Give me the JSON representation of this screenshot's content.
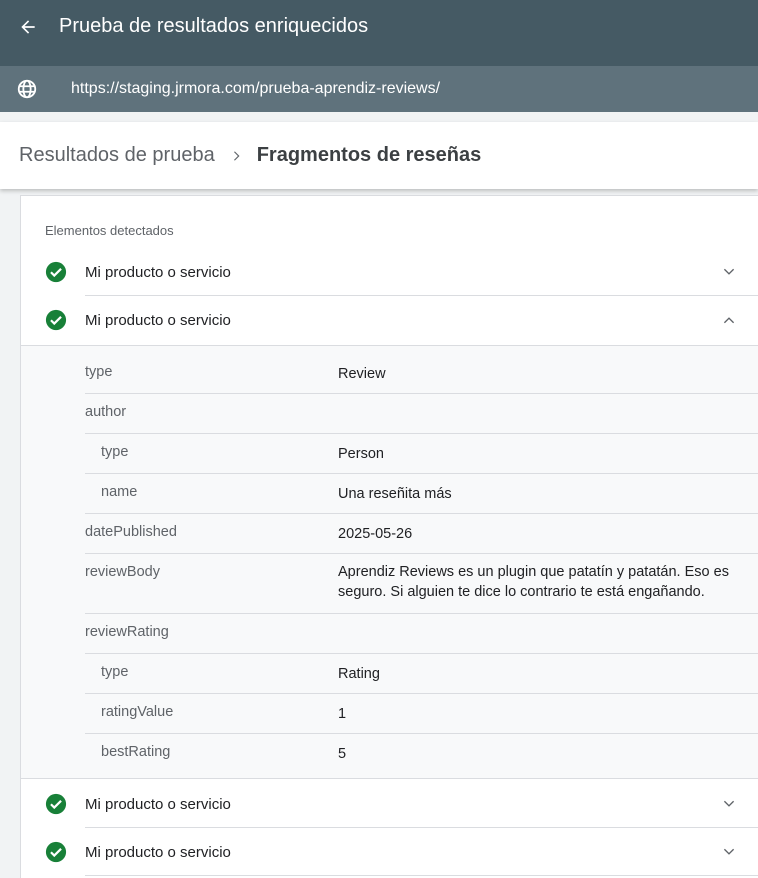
{
  "appbar": {
    "title": "Prueba de resultados enriquecidos",
    "back_icon": "arrow-back-icon"
  },
  "urlbar": {
    "url": "https://staging.jrmora.com/prueba-aprendiz-reviews/",
    "icon": "globe-icon"
  },
  "breadcrumb": {
    "parent": "Resultados de prueba",
    "current": "Fragmentos de reseñas",
    "separator_icon": "chevron-right-icon"
  },
  "detected": {
    "section_label": "Elementos detectados",
    "items": [
      {
        "label": "Mi producto o servicio",
        "expanded": false
      },
      {
        "label": "Mi producto o servicio",
        "expanded": true
      },
      {
        "label": "Mi producto o servicio",
        "expanded": false
      },
      {
        "label": "Mi producto o servicio",
        "expanded": false
      }
    ]
  },
  "properties": [
    {
      "key": "type",
      "value": "Review",
      "nested": false
    },
    {
      "key": "author",
      "value": "",
      "nested": false
    },
    {
      "key": "type",
      "value": "Person",
      "nested": true
    },
    {
      "key": "name",
      "value": "Una reseñita más",
      "nested": true
    },
    {
      "key": "datePublished",
      "value": "2025-05-26",
      "nested": false
    },
    {
      "key": "reviewBody",
      "value": "Aprendiz Reviews es un plugin que patatín y patatán. Eso es seguro. Si alguien te dice lo contrario te está engañando.",
      "nested": false
    },
    {
      "key": "reviewRating",
      "value": "",
      "nested": false
    },
    {
      "key": "type",
      "value": "Rating",
      "nested": true
    },
    {
      "key": "ratingValue",
      "value": "1",
      "nested": true
    },
    {
      "key": "bestRating",
      "value": "5",
      "nested": true
    }
  ],
  "colors": {
    "appbar": "#455a64",
    "urlbar": "#5f727c",
    "check": "#188038",
    "background": "#f1f3f4"
  }
}
